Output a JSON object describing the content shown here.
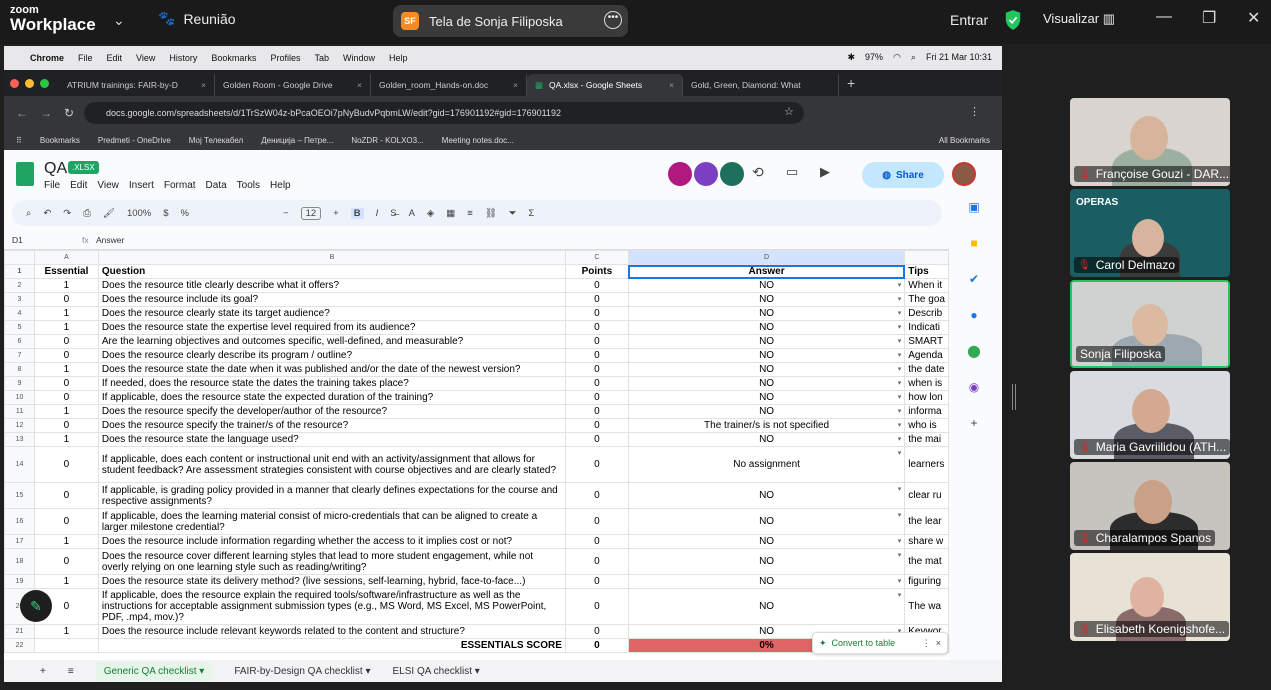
{
  "zoom": {
    "brand_top": "zoom",
    "brand_bottom": "Workplace",
    "meeting_label": "Reunião",
    "share_title": "Tela de Sonja Filiposka",
    "share_avatar": "SF",
    "enter_label": "Entrar",
    "view_label": "Visualizar"
  },
  "mac": {
    "app": "Chrome",
    "menus": [
      "File",
      "Edit",
      "View",
      "History",
      "Bookmarks",
      "Profiles",
      "Tab",
      "Window",
      "Help"
    ],
    "battery": "97%",
    "datetime": "Fri 21 Mar  10:31"
  },
  "browser": {
    "tabs": [
      {
        "label": "ATRIUM trainings: FAIR-by-D"
      },
      {
        "label": "Golden Room - Google Drive"
      },
      {
        "label": "Golden_room_Hands-on.doc"
      },
      {
        "label": "QA.xlsx - Google Sheets"
      },
      {
        "label": "Gold, Green, Diamond: What"
      }
    ],
    "url": "docs.google.com/spreadsheets/d/1TrSzW04z-bPcaOEOi7pNyBudvPqbmLW/edit?gid=176901192#gid=176901192",
    "bookmarks": [
      "Bookmarks",
      "Predmeti - OneDrive",
      "Мој Телекабел",
      "Деницијa – Петре...",
      "NoZDR - KOLXO3...",
      "Meeting notes.doc...",
      "All Bookmarks"
    ]
  },
  "sheets": {
    "title": "QA",
    "badge": ".XLSX",
    "menus": [
      "File",
      "Edit",
      "View",
      "Insert",
      "Format",
      "Data",
      "Tools",
      "Help"
    ],
    "share_label": "Share",
    "zoom_level": "100%",
    "font_size": "12",
    "cell_ref": "D1",
    "formula": "Answer",
    "columns": [
      "A",
      "B",
      "C",
      "D"
    ],
    "headers": {
      "essential": "Essential",
      "question": "Question",
      "points": "Points",
      "answer": "Answer",
      "tips": "Tips"
    },
    "rows": [
      {
        "n": "2",
        "e": "1",
        "q": "Does the resource title clearly describe what it offers?",
        "p": "0",
        "a": "NO",
        "t": "When it"
      },
      {
        "n": "3",
        "e": "0",
        "q": "Does the resource include its goal?",
        "p": "0",
        "a": "NO",
        "t": "The goa"
      },
      {
        "n": "4",
        "e": "1",
        "q": "Does the resource clearly state its target audience?",
        "p": "0",
        "a": "NO",
        "t": "Describ"
      },
      {
        "n": "5",
        "e": "1",
        "q": "Does the resource state the expertise level required from its audience?",
        "p": "0",
        "a": "NO",
        "t": "Indicati"
      },
      {
        "n": "6",
        "e": "0",
        "q": "Are the learning objectives and outcomes specific, well-defined, and measurable?",
        "p": "0",
        "a": "NO",
        "t": "SMART"
      },
      {
        "n": "7",
        "e": "0",
        "q": "Does the resource clearly describe its program / outline?",
        "p": "0",
        "a": "NO",
        "t": "Agenda"
      },
      {
        "n": "8",
        "e": "1",
        "q": "Does the resource state the date when it was published and/or the date of the newest version?",
        "p": "0",
        "a": "NO",
        "t": "the date"
      },
      {
        "n": "9",
        "e": "0",
        "q": "If needed, does the resource state the dates the training takes place?",
        "p": "0",
        "a": "NO",
        "t": "when is"
      },
      {
        "n": "10",
        "e": "0",
        "q": "If applicable, does the resource state the expected duration of the training?",
        "p": "0",
        "a": "NO",
        "t": "how lon"
      },
      {
        "n": "11",
        "e": "1",
        "q": "Does the resource specify the developer/author of the resource?",
        "p": "0",
        "a": "NO",
        "t": "informa"
      },
      {
        "n": "12",
        "e": "0",
        "q": "Does the resource specify the trainer/s of the resource?",
        "p": "0",
        "a": "The trainer/s is not specified",
        "t": "who is"
      },
      {
        "n": "13",
        "e": "1",
        "q": "Does the resource state the language used?",
        "p": "0",
        "a": "NO",
        "t": "the mai"
      },
      {
        "n": "14",
        "e": "0",
        "q": "If applicable, does each content or instructional unit end with an activity/assignment that allows for student feedback? Are assessment strategies consistent with course objectives and are clearly stated?",
        "p": "0",
        "a": "No assignment",
        "t": "learners"
      },
      {
        "n": "15",
        "e": "0",
        "q": "If applicable, is grading policy provided in a manner that clearly defines expectations for the course and respective assignments?",
        "p": "0",
        "a": "NO",
        "t": "clear ru"
      },
      {
        "n": "16",
        "e": "0",
        "q": "If applicable, does the learning material consist of micro-credentials that can be aligned to create a larger milestone credential?",
        "p": "0",
        "a": "NO",
        "t": "the lear"
      },
      {
        "n": "17",
        "e": "1",
        "q": "Does the resource include information regarding whether the access to it implies cost or not?",
        "p": "0",
        "a": "NO",
        "t": "share w"
      },
      {
        "n": "18",
        "e": "0",
        "q": "Does the resource cover different learning styles that lead to more student engagement, while not overly relying on one learning style such as reading/writing?",
        "p": "0",
        "a": "NO",
        "t": "the mat"
      },
      {
        "n": "19",
        "e": "1",
        "q": "Does the resource state its delivery method? (live sessions, self-learning, hybrid, face-to-face...)",
        "p": "0",
        "a": "NO",
        "t": "figuring"
      },
      {
        "n": "20",
        "e": "0",
        "q": "If applicable, does the resource explain the required tools/software/infrastructure as well as the instructions for acceptable assignment submission types (e.g., MS Word, MS Excel, MS PowerPoint, PDF, .mp4, mov.)?",
        "p": "0",
        "a": "NO",
        "t": "The wa"
      },
      {
        "n": "21",
        "e": "1",
        "q": "Does the resource include relevant keywords related to the content and structure?",
        "p": "0",
        "a": "NO",
        "t": "Keywor"
      }
    ],
    "score_row": {
      "n": "22",
      "label": "ESSENTIALS SCORE",
      "points": "0",
      "answer": "0%"
    },
    "convert_label": "Convert to table",
    "sheet_tabs": [
      "Generic QA checklist",
      "FAIR-by-Design QA checklist",
      "ELSI QA checklist"
    ],
    "score_color": "#e06666"
  },
  "participants": [
    {
      "name": "Françoise Gouzi - DAR..."
    },
    {
      "name": "Carol Delmazo"
    },
    {
      "name": "Sonja Filiposka"
    },
    {
      "name": "Maria Gavriilidou (ATH..."
    },
    {
      "name": "Charalampos Spanos"
    },
    {
      "name": "Elisabeth Koenigshofe..."
    }
  ],
  "operas_logo": "OPERAS"
}
